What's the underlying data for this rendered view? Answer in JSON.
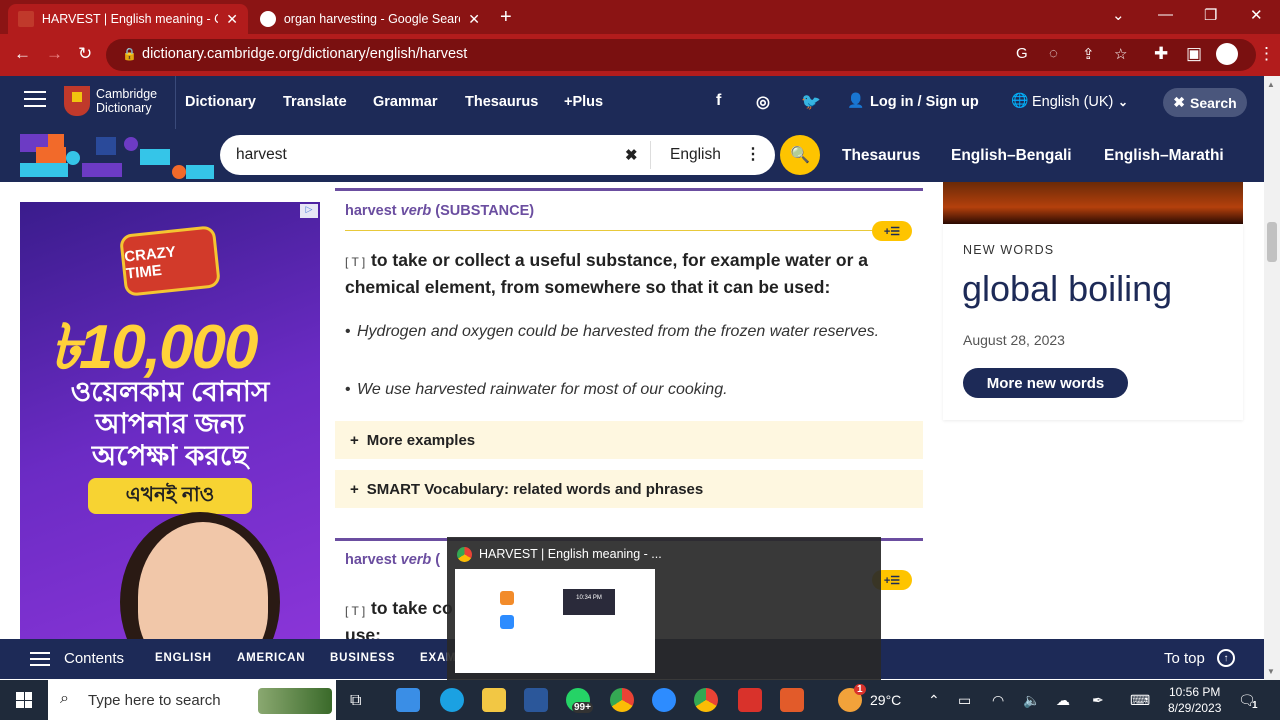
{
  "browser": {
    "tabs": [
      {
        "title": "HARVEST | English meaning - Ca",
        "active": true
      },
      {
        "title": "organ harvesting - Google Search",
        "active": false
      }
    ],
    "url": "dictionary.cambridge.org/dictionary/english/harvest",
    "colors": {
      "tabbar": "#8b1414",
      "toolbar": "#b21c1c"
    }
  },
  "site": {
    "logo": {
      "line1": "Cambridge",
      "line2": "Dictionary"
    },
    "nav": [
      "Dictionary",
      "Translate",
      "Grammar",
      "Thesaurus",
      "+Plus"
    ],
    "login": "Log in / Sign up",
    "language": "English (UK)",
    "search_button": "Search",
    "search_query": "harvest",
    "search_lang": "English",
    "bar_links": [
      "Thesaurus",
      "English–Bengali",
      "English–Marathi"
    ],
    "colors": {
      "navy": "#1d2a57",
      "yellow": "#fec400",
      "purple": "#6b4ea0"
    }
  },
  "ad": {
    "logo": "CRAZY TIME",
    "amount": "৳10,000",
    "line1": "ওয়েলকাম বোনাস",
    "line2": "আপনার জন্য",
    "line3": "অপেক্ষা করছে",
    "button": "এখনই নাও"
  },
  "entry": {
    "headword": "harvest",
    "pos": "verb",
    "guide": "(SUBSTANCE)",
    "grammar": "[ T ]",
    "definition": "to take or collect a useful substance, for example water or a chemical element, from somewhere so that it can be used:",
    "examples": [
      "Hydrogen and oxygen could be harvested from the frozen water reserves.",
      "We use harvested rainwater for most of our cooking."
    ],
    "more_examples": "More examples",
    "smart_vocab": "SMART Vocabulary: related words and phrases",
    "plus_list": "+☰"
  },
  "entry2": {
    "headword": "harvest",
    "pos": "verb",
    "guide": "(",
    "grammar": "[ T ]",
    "definition_start": "to take co",
    "definition_line2": "use:"
  },
  "new_words": {
    "label": "NEW WORDS",
    "word": "global boiling",
    "date": "August 28, 2023",
    "button": "More new words"
  },
  "contents_bar": {
    "title": "Contents",
    "links": [
      "ENGLISH",
      "AMERICAN",
      "BUSINESS",
      "EXAM"
    ],
    "to_top": "To top"
  },
  "thumbnail": {
    "title": "HARVEST | English meaning - ...",
    "inner_time": "10:34 PM"
  },
  "taskbar": {
    "search_placeholder": "Type here to search",
    "whatsapp_badge": "99+",
    "weather": "29°C",
    "weather_badge": "1",
    "time": "10:56 PM",
    "date": "8/29/2023",
    "notif_count": "1"
  }
}
